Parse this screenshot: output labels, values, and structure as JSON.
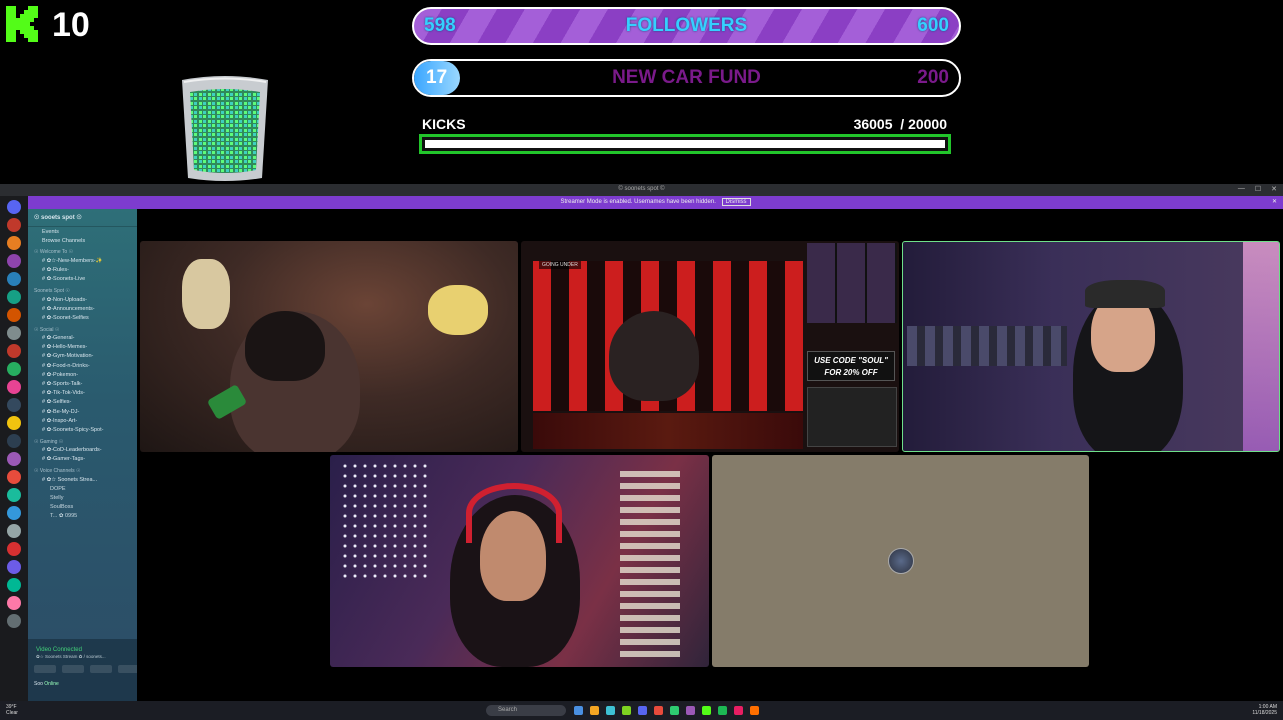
{
  "overlay": {
    "kick_count": "10",
    "followers_goal": {
      "current": "598",
      "title": "FOLLOWERS",
      "target": "600",
      "progress": 0.997
    },
    "car_fund_goal": {
      "current": "17",
      "title": "NEW CAR FUND",
      "target": "200",
      "progress": 0.085
    },
    "kicks": {
      "label": "KICKS",
      "current": "36005",
      "separator": "  / ",
      "target": "20000",
      "progress": 1.0
    }
  },
  "discord": {
    "window_title": "© soonets spot ©",
    "banner_text": "Streamer Mode is enabled. Usernames have been hidden.",
    "banner_dismiss": "Dismiss",
    "server_name": "☉ sooets spot ☉",
    "top_items": [
      "Events",
      "Browse Channels"
    ],
    "categories": [
      {
        "name": "☉ Welcome To ☉",
        "channels": [
          "✿☆-New-Members-✨",
          "✿-Rules-",
          "✿-Soonets-Live"
        ]
      },
      {
        "name": "Soonets Spot ☉",
        "channels": [
          "✿-Non-Uploads-",
          "✿-Announcements-",
          "✿-Soonet-Selfies"
        ]
      },
      {
        "name": "☉ Social ☉",
        "channels": [
          "✿-General-",
          "✿-Hello-Memes-",
          "✿-Gym-Motivation-",
          "✿-Food-n-Drinks-",
          "✿-Pokemon-",
          "✿-Sports-Talk-",
          "✿-Tik-Tok-Vids-",
          "✿-Selfies-",
          "✿-Be-My-DJ-",
          "✿-Inspo-Art-",
          "✿-Soonets-Spicy-Spot-"
        ]
      },
      {
        "name": "☉ Gaming ☉",
        "channels": [
          "✿-CoD-Leaderboards-",
          "✿-Gamer-Tags-"
        ]
      },
      {
        "name": "☉ Voice Channels ☉",
        "channels": [
          "✿☆ Soonets Strea..."
        ]
      }
    ],
    "voice_users": [
      "DOPE",
      "Stelly",
      "SoulBoss",
      "T... ✿ 0995"
    ],
    "vc_status": "Video Connected",
    "vc_sub": "✿☆ Soonets Stream ✿ / soonets...",
    "user_name": "Soo",
    "user_status": "Online"
  },
  "stage": {
    "cam2_label": "GOING UNDER",
    "promo_code_text": "USE CODE \"SOUL\" FOR 20% OFF"
  },
  "taskbar": {
    "weather_temp": "39°F",
    "weather_desc": "Clear",
    "search_placeholder": "Search",
    "time": "1:00 AM",
    "date": "11/18/2025"
  },
  "colors": {
    "kick_green": "#53fc18",
    "followers_purple": "#9b4fd4",
    "followers_text": "#35d0ff",
    "car_fund_text": "#7a1a8a",
    "kicks_border": "#22c52b",
    "discord_banner": "#7d3ccf",
    "vc_green": "#43d17a"
  }
}
